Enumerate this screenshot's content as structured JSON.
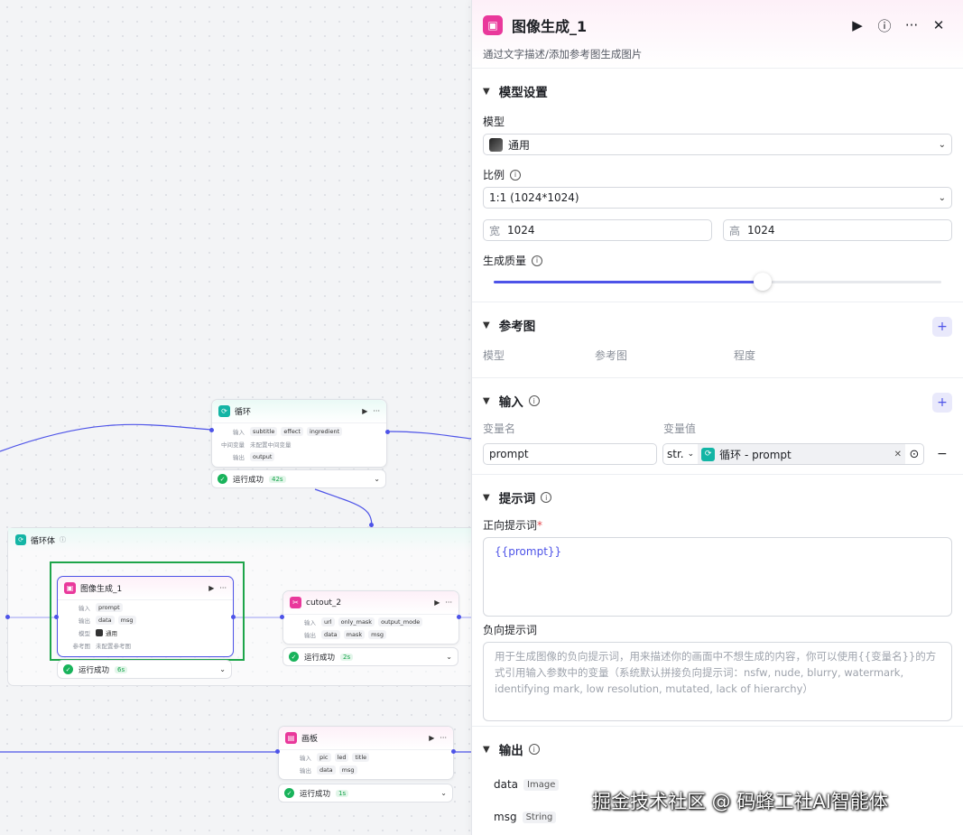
{
  "canvas": {
    "loop_node": {
      "title": "循环",
      "input_label": "输入",
      "inputs": [
        "subtitle",
        "effect",
        "ingredient"
      ],
      "mid_label": "中间变量",
      "mid_text": "未配置中间变量",
      "output_label": "输出",
      "outputs": [
        "output"
      ],
      "status": "运行成功",
      "time": "42s"
    },
    "loop_body": {
      "title": "循环体"
    },
    "image_node": {
      "title": "图像生成_1",
      "input_label": "输入",
      "inputs": [
        "prompt"
      ],
      "output_label": "输出",
      "outputs": [
        "data",
        "msg"
      ],
      "model_label": "模型",
      "model_value": "通用",
      "ref_label": "参考图",
      "ref_text": "未配置参考图",
      "status": "运行成功",
      "time": "6s"
    },
    "cutout_node": {
      "title": "cutout_2",
      "input_label": "输入",
      "inputs": [
        "url",
        "only_mask",
        "output_mode"
      ],
      "output_label": "输出",
      "outputs": [
        "data",
        "mask",
        "msg"
      ],
      "status": "运行成功",
      "time": "2s"
    },
    "canvas_node": {
      "title": "画板",
      "input_label": "输入",
      "inputs": [
        "pic",
        "led",
        "title"
      ],
      "output_label": "输出",
      "outputs": [
        "data",
        "msg"
      ],
      "status": "运行成功",
      "time": "1s"
    }
  },
  "panel": {
    "title": "图像生成_1",
    "description": "通过文字描述/添加参考图生成图片",
    "model_section": {
      "heading": "模型设置",
      "model_label": "模型",
      "model_value": "通用",
      "ratio_label": "比例",
      "ratio_value": "1:1 (1024*1024)",
      "width_label": "宽",
      "width_value": "1024",
      "height_label": "高",
      "height_value": "1024",
      "quality_label": "生成质量",
      "quality_fraction": 0.6
    },
    "ref_section": {
      "heading": "参考图",
      "cols": [
        "模型",
        "参考图",
        "程度"
      ]
    },
    "input_section": {
      "heading": "输入",
      "col_name": "变量名",
      "col_value": "变量值",
      "var_name": "prompt",
      "var_type": "str.",
      "var_ref": "循环 - prompt"
    },
    "prompt_section": {
      "heading": "提示词",
      "positive_label": "正向提示词",
      "positive_value": "{{prompt}}",
      "negative_label": "负向提示词",
      "negative_placeholder": "用于生成图像的负向提示词，用来描述你的画面中不想生成的内容，你可以使用{{变量名}}的方式引用输入参数中的变量（系统默认拼接负向提示词：nsfw, nude, blurry, watermark, identifying mark, low resolution, mutated, lack of hierarchy）"
    },
    "output_section": {
      "heading": "输出",
      "outputs": [
        {
          "name": "data",
          "type": "Image"
        },
        {
          "name": "msg",
          "type": "String"
        }
      ]
    }
  },
  "watermark": "掘金技术社区 @ 码蜂工社AI智能体",
  "colors": {
    "accent": "#4d53e8",
    "image_node": "#e9389b",
    "loop_node": "#13b5a5",
    "success": "#19b35b"
  }
}
